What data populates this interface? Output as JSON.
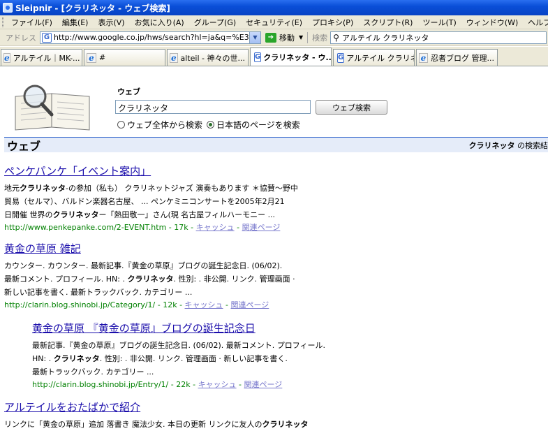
{
  "window": {
    "title": "Sleipnir - [クラリネッタ - ウェブ検索]"
  },
  "menu": [
    "ファイル(F)",
    "編集(E)",
    "表示(V)",
    "お気に入り(A)",
    "グループ(G)",
    "セキュリティ(E)",
    "プロキシ(P)",
    "スクリプト(R)",
    "ツール(T)",
    "ウィンドウ(W)",
    "ヘルプ(H)"
  ],
  "address": {
    "label": "アドレス",
    "url": "http://www.google.co.jp/hws/search?hl=ja&q=%E3%82%A",
    "go_label": "移動",
    "search_label": "検索",
    "search_value": "アルテイル クラリネッタ"
  },
  "tabs": [
    {
      "label": "アルテイル｜MK-...",
      "icon": "ie-icon"
    },
    {
      "label": "#",
      "icon": "ie-icon"
    },
    {
      "label": "alteil - 神々の世...",
      "icon": "ie-icon"
    },
    {
      "label": "クラリネッタ - ウ...",
      "icon": "google-icon",
      "active": true
    },
    {
      "label": "アルテイル クラリネ...",
      "icon": "google-icon"
    },
    {
      "label": "忍者ブログ 管理...",
      "icon": "ie-icon"
    }
  ],
  "search": {
    "web_label": "ウェブ",
    "query": "クラリネッタ",
    "button": "ウェブ検索",
    "radio_all": "ウェブ全体から検索",
    "radio_jp": "日本語のページを検索",
    "selected": "jp"
  },
  "resultbar": {
    "title": "ウェブ",
    "query_bold": "クラリネッタ",
    "suffix": " の検索結"
  },
  "results": [
    {
      "title": "ペンケパンケ「イベント案内」",
      "lines": [
        "地元クラリネッタ-の参加（私も） クラリネットジャズ 演奏もあります ＊協賛～野中",
        "貿易（セルマ）、バルドン楽器名古屋、 ... ペンケミニコンサートを2005年2月21",
        "日開催 世界のクラリネッター「熱田敬一」さん(現 名古屋フィルハーモニー ..."
      ],
      "url": "http://www.penkepanke.com/2-EVENT.htm - 17k",
      "cache": "キャッシュ",
      "related": "関連ページ"
    },
    {
      "title": "黄金の草原 雑記",
      "lines": [
        "カウンター. カウンター. 最新記事.『黄金の草原』ブログの誕生記念日. (06/02).",
        "最新コメント. プロフィール. HN: . クラリネッタ. 性別: . 非公開. リンク. 管理画面 ·",
        "新しい記事を書く. 最新トラックバック. カテゴリー ..."
      ],
      "url": "http://clarin.blog.shinobi.jp/Category/1/ - 12k",
      "cache": "キャッシュ",
      "related": "関連ページ"
    },
    {
      "title": "黄金の草原 『黄金の草原』ブログの誕生記念日",
      "lines": [
        "最新記事.『黄金の草原』ブログの誕生記念日. (06/02). 最新コメント. プロフィール.",
        "HN: . クラリネッタ. 性別: . 非公開. リンク. 管理画面 · 新しい記事を書く.",
        "最新トラックバック. カテゴリー ..."
      ],
      "url": "http://clarin.blog.shinobi.jp/Entry/1/ - 22k",
      "cache": "キャッシュ",
      "related": "関連ページ"
    },
    {
      "title": "アルテイルをおたばかで紹介",
      "lines": [
        "リンクに「黄金の草原」追加 落書き 魔法少女. 本日の更新 リンクに友人のクラリネッタ"
      ]
    }
  ]
}
